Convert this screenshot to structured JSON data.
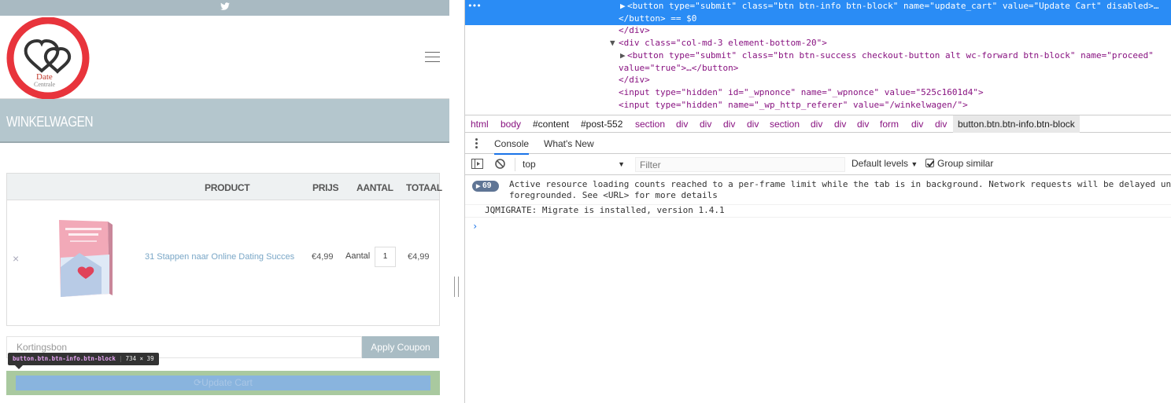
{
  "site": {
    "logo": {
      "line1": "Date",
      "line2": "Centrale"
    },
    "page_title": "WINKELWAGEN",
    "cart": {
      "columns": [
        "PRODUCT",
        "PRIJS",
        "AANTAL",
        "TOTAAL"
      ],
      "row": {
        "remove": "×",
        "product": "31 Stappen naar Online Dating Succes",
        "price": "€4,99",
        "qty_label": "Aantal",
        "qty": "1",
        "total": "€4,99"
      }
    },
    "coupon_placeholder": "Kortingsbon",
    "apply_coupon": "Apply Coupon",
    "update_cart": "Update Cart",
    "tooltip": {
      "selector": "button.btn.btn-info.btn-block",
      "size": "734 × 39"
    }
  },
  "devtools": {
    "elements": [
      {
        "indent": "▶",
        "text": "<button type=\"submit\" class=\"btn btn-info btn-block\" name=\"update_cart\" value=\"Update Cart\" disabled>…"
      },
      {
        "text": "</button> == $0"
      },
      {
        "text": "</div>"
      },
      {
        "indent": "▼",
        "text": "<div class=\"col-md-3 element-bottom-20\">"
      },
      {
        "indent": "▶",
        "text": "<button type=\"submit\" class=\"btn btn-success checkout-button alt wc-forward btn-block\" name=\"proceed\""
      },
      {
        "text": "value=\"true\">…</button>"
      },
      {
        "text": "</div>"
      },
      {
        "text": "<input type=\"hidden\" id=\"_wpnonce\" name=\"_wpnonce\" value=\"525c1601d4\">"
      },
      {
        "text": "<input type=\"hidden\" name=\"_wp_http_referer\" value=\"/winkelwagen/\">"
      }
    ],
    "breadcrumbs": [
      "html",
      "body",
      "#content",
      "#post-552",
      "section",
      "div",
      "div",
      "div",
      "div",
      "section",
      "div",
      "div",
      "div",
      "form",
      "div",
      "div",
      "button.btn.btn-info.btn-block"
    ],
    "tabs": [
      "Console",
      "What's New"
    ],
    "context": "top",
    "filter_placeholder": "Filter",
    "levels": "Default levels",
    "group_similar": "Group similar",
    "messages": [
      {
        "count": "69",
        "line1": "Active resource loading counts reached to a per-frame limit while the tab is in background. Network requests will be delayed until a previous loading finishes or the tab is",
        "line2": "foregrounded. See <URL> for more details"
      },
      {
        "line1": "JQMIGRATE: Migrate is installed, version 1.4.1"
      }
    ],
    "prompt": "›"
  }
}
